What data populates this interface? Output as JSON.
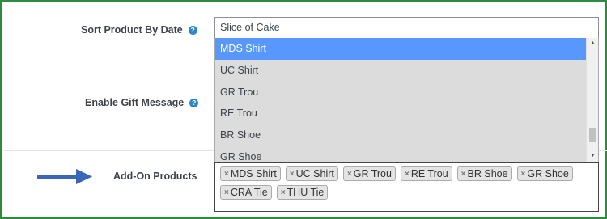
{
  "form": {
    "sort_label": "Sort Product By Date",
    "gift_label": "Enable Gift Message",
    "addon_label": "Add-On Products",
    "help_glyph": "?",
    "search_value": "Slice of Cake",
    "options": [
      "MDS Shirt",
      "UC Shirt",
      "GR Trou",
      "RE Trou",
      "BR Shoe",
      "GR Shoe"
    ],
    "selected_option": "MDS Shirt",
    "tags": [
      "MDS Shirt",
      "UC Shirt",
      "GR Trou",
      "RE Trou",
      "BR Shoe",
      "GR Shoe",
      "CRA Tie",
      "THU Tie"
    ],
    "tag_remove_glyph": "×"
  },
  "colors": {
    "selected_option": "#5897fb",
    "dropdown_background": "#dcdcdc",
    "arrow": "#3a66b8",
    "frame_border": "#2e8b3d",
    "help_icon": "#2c86c8"
  },
  "icons": {
    "help": "question-circle-icon",
    "arrow": "right-arrow-pointer",
    "scroll_up": "triangle-up",
    "scroll_down": "triangle-down"
  }
}
